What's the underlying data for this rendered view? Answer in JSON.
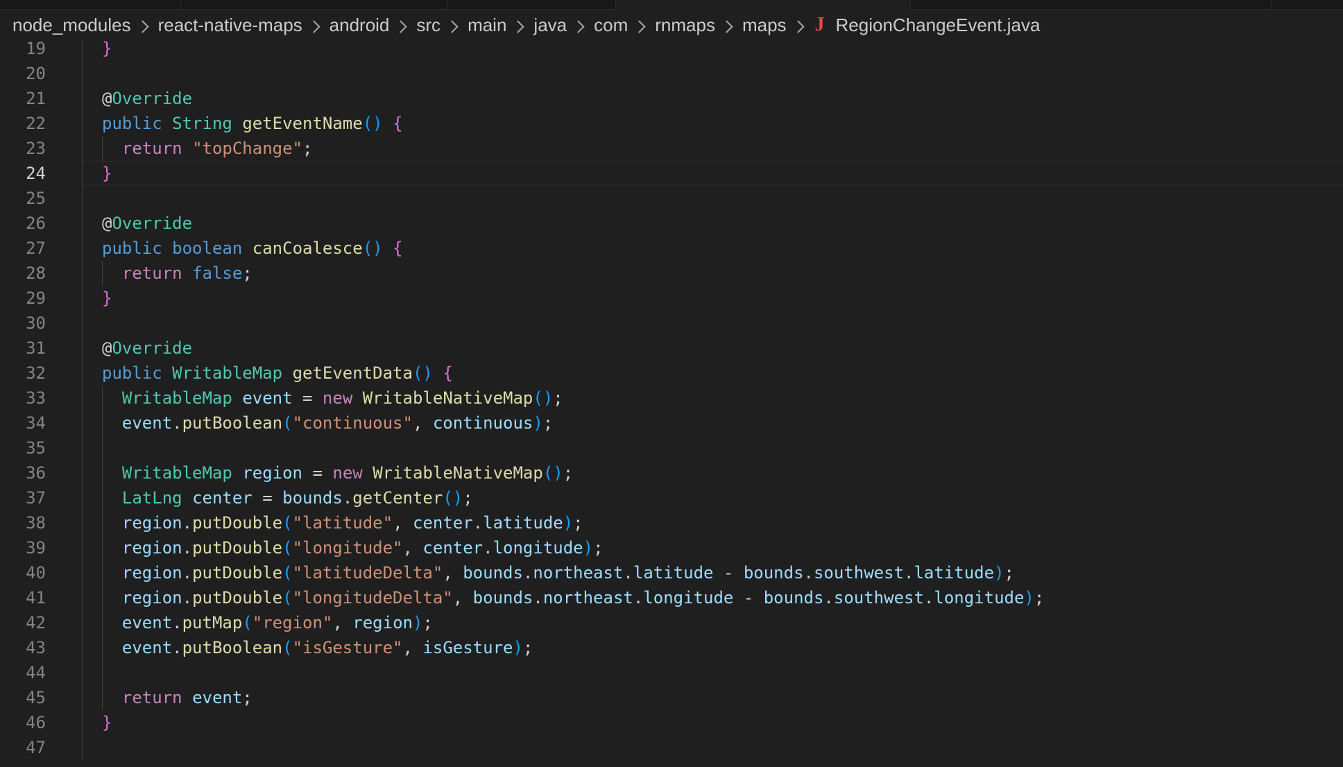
{
  "breadcrumb": {
    "segments": [
      "node_modules",
      "react-native-maps",
      "android",
      "src",
      "main",
      "java",
      "com",
      "rnmaps",
      "maps"
    ],
    "file_icon": "J",
    "file_name": "RegionChangeEvent.java"
  },
  "editor": {
    "active_line": 24,
    "colors": {
      "background": "#1f1f1f",
      "keyword": "#569cd6",
      "control": "#c586c0",
      "type": "#4ec9b0",
      "function": "#dcdcaa",
      "string": "#ce9178",
      "variable": "#9cdcfe",
      "bracket_level1": "#da70d6",
      "bracket_level2": "#179fff",
      "line_number": "#858585"
    },
    "lines": [
      {
        "n": 19,
        "tokens": [
          [
            "}",
            "br1"
          ]
        ]
      },
      {
        "n": 20,
        "tokens": []
      },
      {
        "n": 21,
        "tokens": [
          [
            "@",
            "at"
          ],
          [
            "Override",
            "typ"
          ]
        ]
      },
      {
        "n": 22,
        "tokens": [
          [
            "public",
            "kw"
          ],
          [
            " ",
            ""
          ],
          [
            "String",
            "typ"
          ],
          [
            " ",
            ""
          ],
          [
            "getEventName",
            "fn"
          ],
          [
            "()",
            "br2"
          ],
          [
            " ",
            ""
          ],
          [
            "{",
            "br1"
          ]
        ]
      },
      {
        "n": 23,
        "tokens": [
          [
            "  ",
            ""
          ],
          [
            "return",
            "ctl"
          ],
          [
            " ",
            ""
          ],
          [
            "\"topChange\"",
            "str"
          ],
          [
            ";",
            "punc"
          ]
        ]
      },
      {
        "n": 24,
        "tokens": [
          [
            "}",
            "br1"
          ]
        ]
      },
      {
        "n": 25,
        "tokens": []
      },
      {
        "n": 26,
        "tokens": [
          [
            "@",
            "at"
          ],
          [
            "Override",
            "typ"
          ]
        ]
      },
      {
        "n": 27,
        "tokens": [
          [
            "public",
            "kw"
          ],
          [
            " ",
            ""
          ],
          [
            "boolean",
            "kw"
          ],
          [
            " ",
            ""
          ],
          [
            "canCoalesce",
            "fn"
          ],
          [
            "()",
            "br2"
          ],
          [
            " ",
            ""
          ],
          [
            "{",
            "br1"
          ]
        ]
      },
      {
        "n": 28,
        "tokens": [
          [
            "  ",
            ""
          ],
          [
            "return",
            "ctl"
          ],
          [
            " ",
            ""
          ],
          [
            "false",
            "kw"
          ],
          [
            ";",
            "punc"
          ]
        ]
      },
      {
        "n": 29,
        "tokens": [
          [
            "}",
            "br1"
          ]
        ]
      },
      {
        "n": 30,
        "tokens": []
      },
      {
        "n": 31,
        "tokens": [
          [
            "@",
            "at"
          ],
          [
            "Override",
            "typ"
          ]
        ]
      },
      {
        "n": 32,
        "tokens": [
          [
            "public",
            "kw"
          ],
          [
            " ",
            ""
          ],
          [
            "WritableMap",
            "typ"
          ],
          [
            " ",
            ""
          ],
          [
            "getEventData",
            "fn"
          ],
          [
            "()",
            "br2"
          ],
          [
            " ",
            ""
          ],
          [
            "{",
            "br1"
          ]
        ]
      },
      {
        "n": 33,
        "tokens": [
          [
            "  ",
            ""
          ],
          [
            "WritableMap",
            "typ"
          ],
          [
            " ",
            ""
          ],
          [
            "event",
            "var"
          ],
          [
            " = ",
            "punc"
          ],
          [
            "new",
            "ctl"
          ],
          [
            " ",
            ""
          ],
          [
            "WritableNativeMap",
            "fn"
          ],
          [
            "()",
            "br2"
          ],
          [
            ";",
            "punc"
          ]
        ]
      },
      {
        "n": 34,
        "tokens": [
          [
            "  ",
            ""
          ],
          [
            "event",
            "var"
          ],
          [
            ".",
            "punc"
          ],
          [
            "putBoolean",
            "fn"
          ],
          [
            "(",
            "br2"
          ],
          [
            "\"continuous\"",
            "str"
          ],
          [
            ", ",
            "punc"
          ],
          [
            "continuous",
            "var"
          ],
          [
            ")",
            "br2"
          ],
          [
            ";",
            "punc"
          ]
        ]
      },
      {
        "n": 35,
        "tokens": []
      },
      {
        "n": 36,
        "tokens": [
          [
            "  ",
            ""
          ],
          [
            "WritableMap",
            "typ"
          ],
          [
            " ",
            ""
          ],
          [
            "region",
            "var"
          ],
          [
            " = ",
            "punc"
          ],
          [
            "new",
            "ctl"
          ],
          [
            " ",
            ""
          ],
          [
            "WritableNativeMap",
            "fn"
          ],
          [
            "()",
            "br2"
          ],
          [
            ";",
            "punc"
          ]
        ]
      },
      {
        "n": 37,
        "tokens": [
          [
            "  ",
            ""
          ],
          [
            "LatLng",
            "typ"
          ],
          [
            " ",
            ""
          ],
          [
            "center",
            "var"
          ],
          [
            " = ",
            "punc"
          ],
          [
            "bounds",
            "var"
          ],
          [
            ".",
            "punc"
          ],
          [
            "getCenter",
            "fn"
          ],
          [
            "()",
            "br2"
          ],
          [
            ";",
            "punc"
          ]
        ]
      },
      {
        "n": 38,
        "tokens": [
          [
            "  ",
            ""
          ],
          [
            "region",
            "var"
          ],
          [
            ".",
            "punc"
          ],
          [
            "putDouble",
            "fn"
          ],
          [
            "(",
            "br2"
          ],
          [
            "\"latitude\"",
            "str"
          ],
          [
            ", ",
            "punc"
          ],
          [
            "center",
            "var"
          ],
          [
            ".",
            "punc"
          ],
          [
            "latitude",
            "var"
          ],
          [
            ")",
            "br2"
          ],
          [
            ";",
            "punc"
          ]
        ]
      },
      {
        "n": 39,
        "tokens": [
          [
            "  ",
            ""
          ],
          [
            "region",
            "var"
          ],
          [
            ".",
            "punc"
          ],
          [
            "putDouble",
            "fn"
          ],
          [
            "(",
            "br2"
          ],
          [
            "\"longitude\"",
            "str"
          ],
          [
            ", ",
            "punc"
          ],
          [
            "center",
            "var"
          ],
          [
            ".",
            "punc"
          ],
          [
            "longitude",
            "var"
          ],
          [
            ")",
            "br2"
          ],
          [
            ";",
            "punc"
          ]
        ]
      },
      {
        "n": 40,
        "tokens": [
          [
            "  ",
            ""
          ],
          [
            "region",
            "var"
          ],
          [
            ".",
            "punc"
          ],
          [
            "putDouble",
            "fn"
          ],
          [
            "(",
            "br2"
          ],
          [
            "\"latitudeDelta\"",
            "str"
          ],
          [
            ", ",
            "punc"
          ],
          [
            "bounds",
            "var"
          ],
          [
            ".",
            "punc"
          ],
          [
            "northeast",
            "var"
          ],
          [
            ".",
            "punc"
          ],
          [
            "latitude",
            "var"
          ],
          [
            " - ",
            "punc"
          ],
          [
            "bounds",
            "var"
          ],
          [
            ".",
            "punc"
          ],
          [
            "southwest",
            "var"
          ],
          [
            ".",
            "punc"
          ],
          [
            "latitude",
            "var"
          ],
          [
            ")",
            "br2"
          ],
          [
            ";",
            "punc"
          ]
        ]
      },
      {
        "n": 41,
        "tokens": [
          [
            "  ",
            ""
          ],
          [
            "region",
            "var"
          ],
          [
            ".",
            "punc"
          ],
          [
            "putDouble",
            "fn"
          ],
          [
            "(",
            "br2"
          ],
          [
            "\"longitudeDelta\"",
            "str"
          ],
          [
            ", ",
            "punc"
          ],
          [
            "bounds",
            "var"
          ],
          [
            ".",
            "punc"
          ],
          [
            "northeast",
            "var"
          ],
          [
            ".",
            "punc"
          ],
          [
            "longitude",
            "var"
          ],
          [
            " - ",
            "punc"
          ],
          [
            "bounds",
            "var"
          ],
          [
            ".",
            "punc"
          ],
          [
            "southwest",
            "var"
          ],
          [
            ".",
            "punc"
          ],
          [
            "longitude",
            "var"
          ],
          [
            ")",
            "br2"
          ],
          [
            ";",
            "punc"
          ]
        ]
      },
      {
        "n": 42,
        "tokens": [
          [
            "  ",
            ""
          ],
          [
            "event",
            "var"
          ],
          [
            ".",
            "punc"
          ],
          [
            "putMap",
            "fn"
          ],
          [
            "(",
            "br2"
          ],
          [
            "\"region\"",
            "str"
          ],
          [
            ", ",
            "punc"
          ],
          [
            "region",
            "var"
          ],
          [
            ")",
            "br2"
          ],
          [
            ";",
            "punc"
          ]
        ]
      },
      {
        "n": 43,
        "tokens": [
          [
            "  ",
            ""
          ],
          [
            "event",
            "var"
          ],
          [
            ".",
            "punc"
          ],
          [
            "putBoolean",
            "fn"
          ],
          [
            "(",
            "br2"
          ],
          [
            "\"isGesture\"",
            "str"
          ],
          [
            ", ",
            "punc"
          ],
          [
            "isGesture",
            "var"
          ],
          [
            ")",
            "br2"
          ],
          [
            ";",
            "punc"
          ]
        ]
      },
      {
        "n": 44,
        "tokens": []
      },
      {
        "n": 45,
        "tokens": [
          [
            "  ",
            ""
          ],
          [
            "return",
            "ctl"
          ],
          [
            " ",
            ""
          ],
          [
            "event",
            "var"
          ],
          [
            ";",
            "punc"
          ]
        ]
      },
      {
        "n": 46,
        "tokens": [
          [
            "}",
            "br1"
          ]
        ]
      },
      {
        "n": 47,
        "tokens": []
      }
    ]
  }
}
